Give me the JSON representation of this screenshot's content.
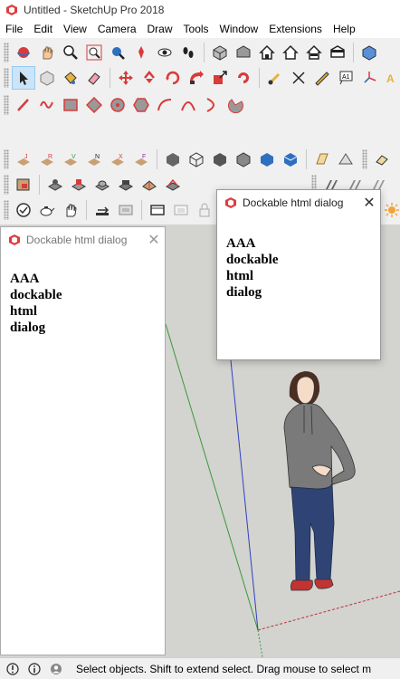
{
  "window": {
    "title": "Untitled - SketchUp Pro 2018",
    "icon": "sketchup-logo-icon"
  },
  "menu": [
    "File",
    "Edit",
    "View",
    "Camera",
    "Draw",
    "Tools",
    "Window",
    "Extensions",
    "Help"
  ],
  "toolbars": {
    "row1": [
      "orbit-icon",
      "pan-icon",
      "zoom-icon",
      "zoom-window-icon",
      "zoom-extents-icon",
      "previous-view-icon",
      "position-camera-icon",
      "look-around-icon",
      "walk-icon",
      "iso-view-icon",
      "top-view-icon",
      "front-view-icon",
      "right-view-icon",
      "back-view-icon",
      "left-view-icon",
      "bottom-view-icon"
    ],
    "row2": [
      "select-icon",
      "make-component-icon",
      "paint-bucket-icon",
      "eraser-icon",
      "move-icon",
      "rotate-icon",
      "scale-icon",
      "push-pull-icon",
      "follow-me-icon",
      "offset-icon",
      "tape-measure-icon",
      "dimension-icon",
      "protractor-icon",
      "text-icon",
      "axes-icon",
      "3d-text-icon"
    ],
    "row3": [
      "line-icon",
      "freehand-icon",
      "rectangle-icon",
      "rotated-rectangle-icon",
      "circle-icon",
      "polygon-icon",
      "arc-icon",
      "2-point-arc-icon",
      "3-point-arc-icon",
      "pie-icon"
    ],
    "row4": [
      "sandbox-from-contours-icon",
      "sandbox-from-scratch-icon",
      "smoove-icon",
      "stamp-icon",
      "drape-icon",
      "add-detail-icon",
      "flip-edge-icon",
      "shaded-icon",
      "wireframe-icon",
      "hidden-line-icon",
      "shaded-textures-icon",
      "monochrome-icon",
      "section-plane-icon",
      "xray-icon"
    ],
    "row5": [
      "solid-outer-shell-icon",
      "solid-intersect-icon",
      "solid-union-icon",
      "solid-subtract-icon",
      "solid-trim-icon",
      "solid-split-icon",
      "style-1-icon",
      "style-2-icon"
    ],
    "row6": [
      "solid-inspector-icon",
      "teapot-icon",
      "hand-icon",
      "dimension-tool-icon",
      "panel-icon",
      "screen-icon",
      "window-icon",
      "lock-icon",
      "sun-icon"
    ]
  },
  "dock_dialog": {
    "title": "Dockable html dialog",
    "close_glyph": "✕",
    "lines": [
      "AAA",
      "dockable",
      "html",
      "dialog"
    ]
  },
  "float_dialog": {
    "title": "Dockable html dialog",
    "close_glyph": "✕",
    "lines": [
      "AAA",
      "dockable",
      "html",
      "dialog"
    ]
  },
  "status": {
    "text": "Select objects. Shift to extend select. Drag mouse to select m",
    "icons": [
      "geo-location-icon",
      "credits-icon",
      "user-icon"
    ]
  },
  "colors": {
    "viewport_bg": "#d3d3d0",
    "axis_red": "#c0303a",
    "axis_green": "#3a9a3a",
    "axis_blue": "#3040c0"
  }
}
